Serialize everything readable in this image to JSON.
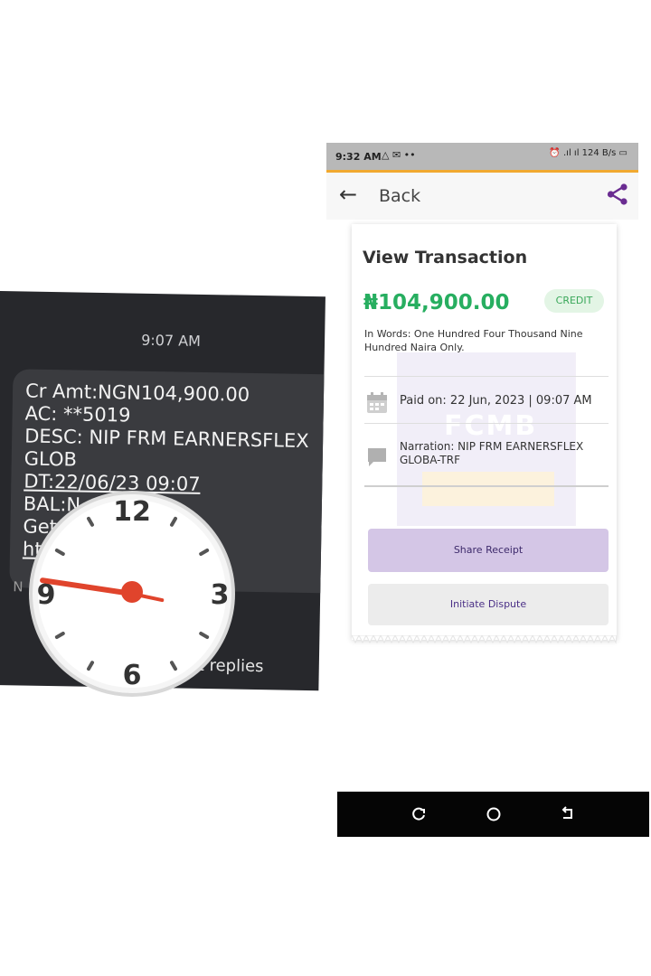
{
  "sms": {
    "time": "9:07 AM",
    "lines": [
      "Cr Amt:NGN104,900.00",
      "AC: **5019",
      "DESC: NIP FRM EARNERSFLEX",
      "GLOB",
      "DT:22/06/23 09:07",
      "BAL:N",
      "Get",
      "ht"
    ],
    "footer_partial": "N",
    "smart_replies": "t replies"
  },
  "clock": {
    "numbers": [
      "12",
      "3",
      "6",
      "9"
    ],
    "hour_value": 9,
    "minute_value": 17,
    "hand_color": "#e0442c"
  },
  "app": {
    "status_bar": {
      "time": "9:32 AM",
      "left_icons": "△ ✉ ••",
      "right_icons": "⏰ .ıl ıl 124 B/s ▭",
      "accent_color": "#f1a930"
    },
    "header": {
      "back_icon": "arrow-left-icon",
      "back_label": "Back",
      "share_icon": "share-icon",
      "share_color": "#6a2c91"
    },
    "transaction": {
      "title": "View Transaction",
      "amount": "₦104,900.00",
      "amount_color": "#27ae60",
      "badge": "CREDIT",
      "in_words": "In Words: One Hundred Four Thousand Nine Hundred Naira  Only.",
      "paid_on": "Paid on: 22 Jun, 2023 | 09:07 AM",
      "narration": "Narration: NIP FRM EARNERSFLEX GLOBA-TRF",
      "watermark_text": "FCMB"
    },
    "buttons": {
      "share_receipt": "Share Receipt",
      "initiate_dispute": "Initiate Dispute"
    }
  },
  "nav": {
    "icons": [
      "recent-apps-icon",
      "home-icon",
      "back-nav-icon"
    ]
  }
}
